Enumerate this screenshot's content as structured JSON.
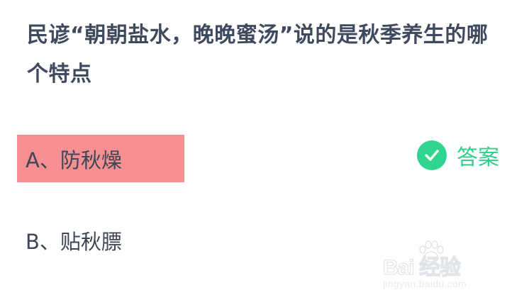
{
  "question": {
    "text": "民谚“朝朝盐水，晚晚蜜汤”说的是秋季养生的哪个特点"
  },
  "options": [
    {
      "label": "A、防秋燥",
      "selected": true
    },
    {
      "label": "B、贴秋膘",
      "selected": false
    }
  ],
  "answer_tag": {
    "label": "答案",
    "icon": "check-circle-icon"
  },
  "watermark": {
    "brand_text": "Bai 经验",
    "url_text": "jingyan.baidu.com"
  },
  "colors": {
    "selected_bg": "#f68f91",
    "answer_green": "#2fd48f",
    "text": "#404a5e"
  }
}
